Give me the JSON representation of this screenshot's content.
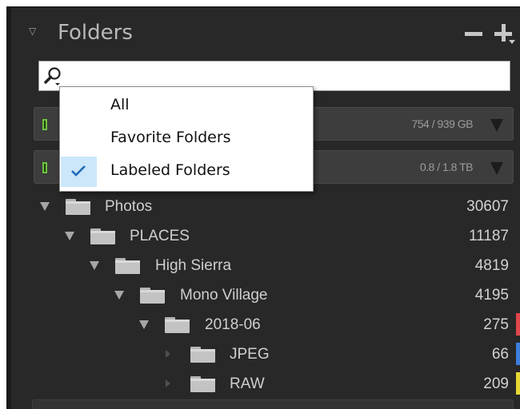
{
  "panel": {
    "title": "Folders"
  },
  "search": {
    "value": "",
    "placeholder": ""
  },
  "filter_menu": {
    "items": [
      {
        "label": "All",
        "checked": false
      },
      {
        "label": "Favorite Folders",
        "checked": false
      },
      {
        "label": "Labeled Folders",
        "checked": true
      }
    ]
  },
  "volumes": [
    {
      "size": "754 / 939 GB",
      "status_color": "#6ec23e"
    },
    {
      "size": "0.8 / 1.8 TB",
      "status_color": "#6ec23e"
    }
  ],
  "tree": [
    {
      "name": "Photos",
      "count": "30607",
      "expanded": true,
      "label_color": ""
    },
    {
      "name": "PLACES",
      "count": "11187",
      "expanded": true,
      "label_color": ""
    },
    {
      "name": "High Sierra",
      "count": "4819",
      "expanded": true,
      "label_color": ""
    },
    {
      "name": "Mono Village",
      "count": "4195",
      "expanded": true,
      "label_color": ""
    },
    {
      "name": "2018-06",
      "count": "275",
      "expanded": true,
      "label_color": "#e0474c"
    },
    {
      "name": "JPEG",
      "count": "66",
      "expanded": false,
      "label_color": "#3d7ede"
    },
    {
      "name": "RAW",
      "count": "209",
      "expanded": false,
      "label_color": "#e6d735"
    }
  ],
  "colors": {
    "panel_bg": "#282828",
    "menu_highlight": "#cce7fa",
    "checkmark": "#1e6ab8"
  }
}
